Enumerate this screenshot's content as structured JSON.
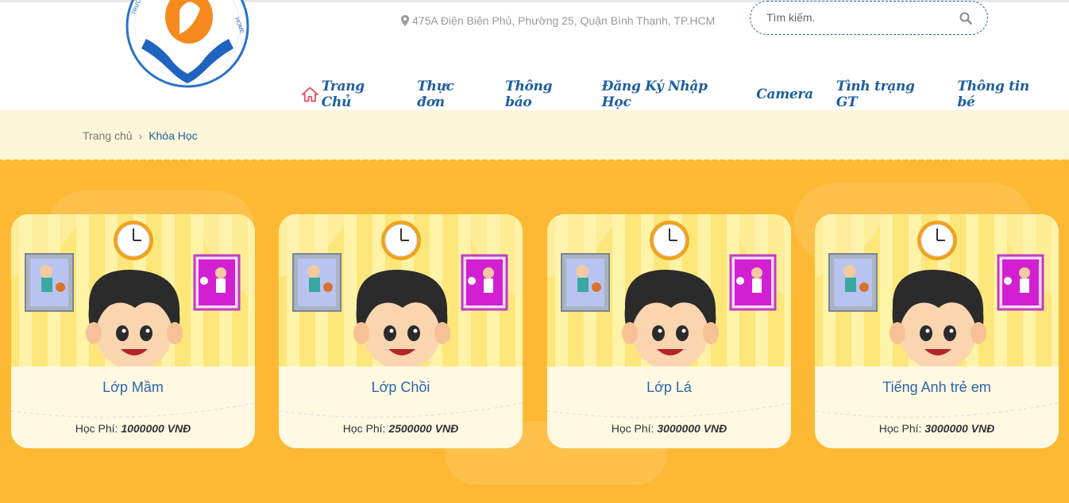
{
  "header": {
    "address": "475A Điện Biên Phủ, Phường 25, Quận Bình Thạnh, TP.HCM",
    "search_placeholder": "Tìm kiếm.",
    "logo_text": "TRƯỜNG ... HOME"
  },
  "nav": [
    {
      "label": "Trang Chủ"
    },
    {
      "label": "Thực đơn"
    },
    {
      "label": "Thông báo"
    },
    {
      "label": "Đăng Ký Nhập Học"
    },
    {
      "label": "Camera"
    },
    {
      "label": "Tình trạng GT"
    },
    {
      "label": "Thông tin bé"
    }
  ],
  "breadcrumb": {
    "home": "Trang chủ",
    "separator": "›",
    "current": "Khóa Học"
  },
  "courses": [
    {
      "name": "Lớp Mầm",
      "fee_label": "Học Phí:",
      "fee": "1000000 VNĐ"
    },
    {
      "name": "Lớp Chồi",
      "fee_label": "Học Phí:",
      "fee": "2500000 VNĐ"
    },
    {
      "name": "Lớp Lá",
      "fee_label": "Học Phí:",
      "fee": "3000000 VNĐ"
    },
    {
      "name": "Tiếng Anh trẻ em",
      "fee_label": "Học Phí:",
      "fee": "3000000 VNĐ"
    }
  ],
  "colors": {
    "brand_blue": "#1e5fa0",
    "main_bg": "#fdb933",
    "crumb_bg": "#fdf6d8",
    "home_icon": "#e05a6a"
  },
  "icons": {
    "address": "map-pin-icon",
    "search": "search-icon",
    "home": "home-icon"
  }
}
